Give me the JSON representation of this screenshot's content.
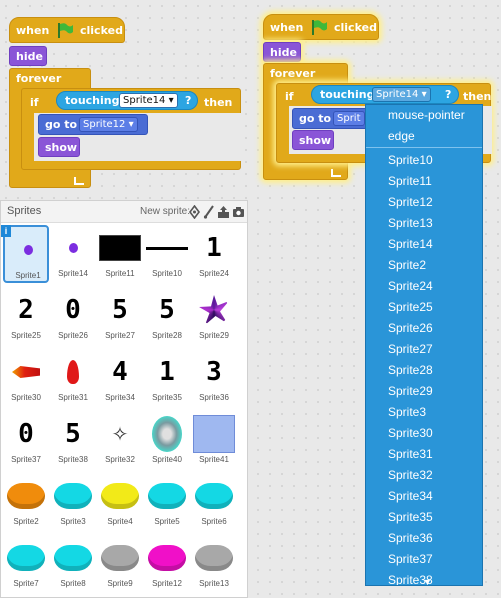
{
  "scripts": {
    "left": {
      "when_label": "when",
      "clicked_label": "clicked",
      "hide_label": "hide",
      "forever_label": "forever",
      "if_label": "if",
      "touching_label": "touching",
      "touching_target": "Sprite14",
      "question_mark": "?",
      "then_label": "then",
      "go_to_label": "go to",
      "go_to_target": "Sprite12",
      "show_label": "show"
    },
    "right": {
      "when_label": "when",
      "clicked_label": "clicked",
      "hide_label": "hide",
      "forever_label": "forever",
      "if_label": "if",
      "touching_label": "touching",
      "touching_target": "Sprite14",
      "question_mark": "?",
      "then_label": "then",
      "go_to_label": "go to",
      "go_to_target": "Sprit",
      "show_label": "show"
    }
  },
  "sprites_panel": {
    "title": "Sprites",
    "new_sprite_label": "New sprite:",
    "info_glyph": "i",
    "sprites": [
      {
        "name": "Sprite1",
        "kind": "dot",
        "selected": true
      },
      {
        "name": "Sprite14",
        "kind": "dot"
      },
      {
        "name": "Sprite11",
        "kind": "black-rect"
      },
      {
        "name": "Sprite10",
        "kind": "line"
      },
      {
        "name": "Sprite24",
        "kind": "digit",
        "glyph": "1"
      },
      {
        "name": "Sprite25",
        "kind": "digit",
        "glyph": "2"
      },
      {
        "name": "Sprite26",
        "kind": "digit",
        "glyph": "0"
      },
      {
        "name": "Sprite27",
        "kind": "digit",
        "glyph": "5"
      },
      {
        "name": "Sprite28",
        "kind": "digit",
        "glyph": "5"
      },
      {
        "name": "Sprite29",
        "kind": "swirl"
      },
      {
        "name": "Sprite30",
        "kind": "rocket-red"
      },
      {
        "name": "Sprite31",
        "kind": "flame"
      },
      {
        "name": "Sprite34",
        "kind": "digit",
        "glyph": "4"
      },
      {
        "name": "Sprite35",
        "kind": "digit",
        "glyph": "1"
      },
      {
        "name": "Sprite36",
        "kind": "digit",
        "glyph": "3"
      },
      {
        "name": "Sprite37",
        "kind": "digit",
        "glyph": "0"
      },
      {
        "name": "Sprite38",
        "kind": "digit",
        "glyph": "5"
      },
      {
        "name": "Sprite32",
        "kind": "sparkle"
      },
      {
        "name": "Sprite40",
        "kind": "portal"
      },
      {
        "name": "Sprite41",
        "kind": "blue-card"
      },
      {
        "name": "Sprite2",
        "kind": "disc",
        "color": "#f08c0c"
      },
      {
        "name": "Sprite3",
        "kind": "disc",
        "color": "#14d8e4"
      },
      {
        "name": "Sprite4",
        "kind": "disc",
        "color": "#f2ea18"
      },
      {
        "name": "Sprite5",
        "kind": "disc",
        "color": "#14d8e4"
      },
      {
        "name": "Sprite6",
        "kind": "disc",
        "color": "#14d8e4"
      },
      {
        "name": "Sprite7",
        "kind": "disc",
        "color": "#14d8e4"
      },
      {
        "name": "Sprite8",
        "kind": "disc",
        "color": "#14d8e4"
      },
      {
        "name": "Sprite9",
        "kind": "disc",
        "color": "#a8a8a8"
      },
      {
        "name": "Sprite12",
        "kind": "disc",
        "color": "#f010c8"
      },
      {
        "name": "Sprite13",
        "kind": "disc",
        "color": "#a8a8a8"
      }
    ]
  },
  "dropdown_menu": {
    "items": [
      "mouse-pointer",
      "edge",
      "Sprite10",
      "Sprite11",
      "Sprite12",
      "Sprite13",
      "Sprite14",
      "Sprite2",
      "Sprite24",
      "Sprite25",
      "Sprite26",
      "Sprite27",
      "Sprite28",
      "Sprite29",
      "Sprite3",
      "Sprite30",
      "Sprite31",
      "Sprite32",
      "Sprite34",
      "Sprite35",
      "Sprite36",
      "Sprite37",
      "Sprite38"
    ]
  },
  "colors": {
    "control": "#e1a91a",
    "looks": "#8a55d7",
    "sensing": "#2ca5e2",
    "motion": "#4a6cd4",
    "menu": "#2a95d8",
    "flag": "#3fb83a"
  }
}
